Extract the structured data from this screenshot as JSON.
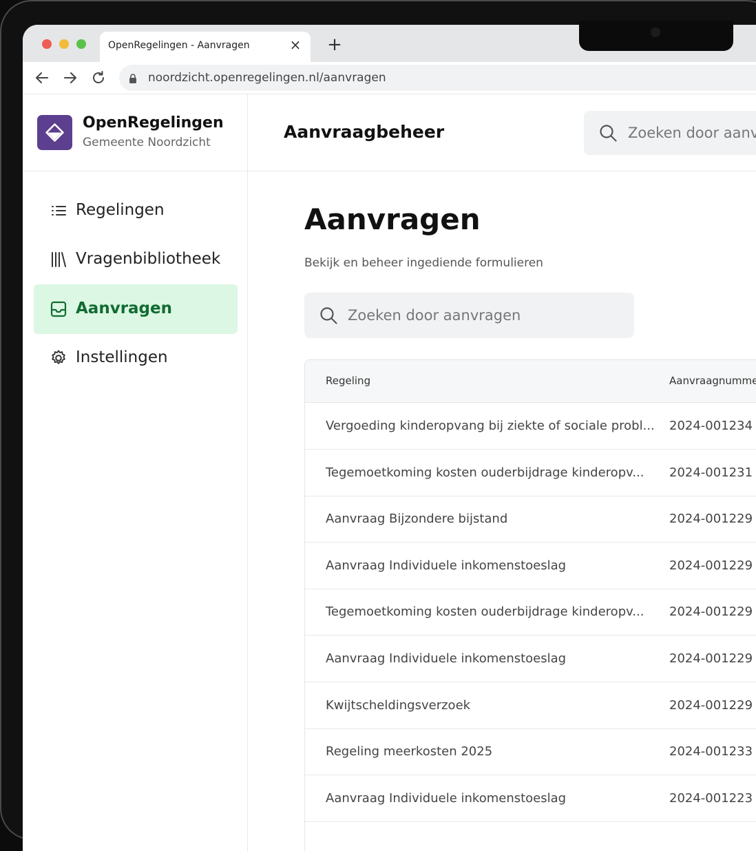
{
  "browser": {
    "tab_title": "OpenRegelingen - Aanvragen",
    "url": "noordzicht.openregelingen.nl/aanvragen"
  },
  "brand": {
    "name": "OpenRegelingen",
    "subtitle": "Gemeente Noordzicht",
    "color": "#5c3f8e"
  },
  "sidebar": {
    "items": [
      {
        "label": "Regelingen",
        "icon": "list-icon",
        "active": false
      },
      {
        "label": "Vragenbibliotheek",
        "icon": "library-icon",
        "active": false
      },
      {
        "label": "Aanvragen",
        "icon": "inbox-icon",
        "active": true
      },
      {
        "label": "Instellingen",
        "icon": "gear-icon",
        "active": false
      }
    ],
    "active_color": "#126b32",
    "active_bg": "#dcf7e3"
  },
  "header": {
    "title": "Aanvraagbeheer",
    "search_placeholder": "Zoeken door aanvra"
  },
  "page": {
    "title": "Aanvragen",
    "subtitle": "Bekijk en beheer ingediende formulieren",
    "search_placeholder": "Zoeken door aanvragen"
  },
  "table": {
    "columns": [
      "Regeling",
      "Aanvraagnummer"
    ],
    "rows": [
      {
        "regeling": "Vergoeding kinderopvang bij ziekte of sociale probl...",
        "nummer": "2024-001234"
      },
      {
        "regeling": "Tegemoetkoming kosten ouderbijdrage kinderopv...",
        "nummer": "2024-001231"
      },
      {
        "regeling": "Aanvraag Bijzondere bijstand",
        "nummer": "2024-001229"
      },
      {
        "regeling": "Aanvraag Individuele inkomenstoeslag",
        "nummer": "2024-001229"
      },
      {
        "regeling": "Tegemoetkoming kosten ouderbijdrage kinderopv...",
        "nummer": "2024-001229"
      },
      {
        "regeling": "Aanvraag Individuele inkomenstoeslag",
        "nummer": "2024-001229"
      },
      {
        "regeling": "Kwijtscheldingsverzoek",
        "nummer": "2024-001229"
      },
      {
        "regeling": "Regeling meerkosten 2025",
        "nummer": "2024-001233"
      },
      {
        "regeling": "Aanvraag Individuele inkomenstoeslag",
        "nummer": "2024-001223"
      }
    ]
  }
}
